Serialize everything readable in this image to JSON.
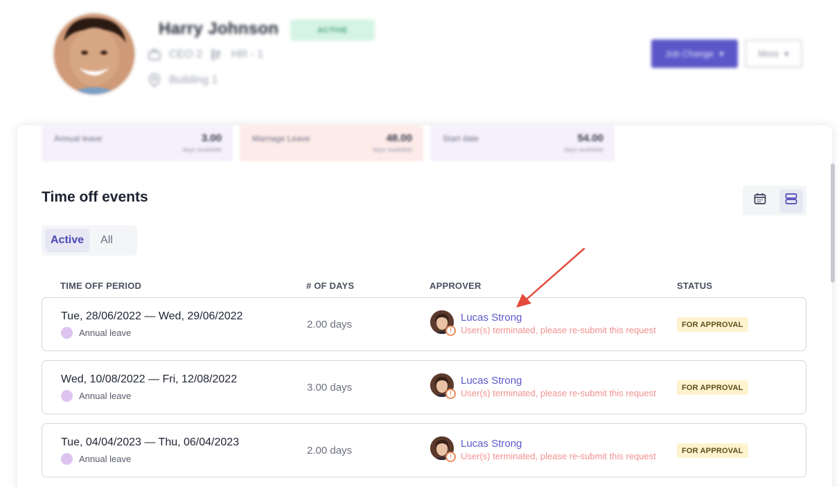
{
  "colors": {
    "accent": "#5b57c9",
    "warning": "#ef8a58",
    "error_text": "#f0918e",
    "status_bg": "#fdf3cf",
    "leave_dot": "#dcc4ef",
    "annotation_arrow": "#e34a3b"
  },
  "employee": {
    "name": "Harry Johnson",
    "status": "ACTIVE",
    "position": "CEO 2",
    "department": "HR - 1",
    "location": "Building 1"
  },
  "header_actions": {
    "job_change_label": "Job Change",
    "more_label": "More"
  },
  "balances": [
    {
      "name": "Annual leave",
      "value": "3.00",
      "sub": "days available"
    },
    {
      "name": "Marriage Leave",
      "value": "48.00",
      "sub": "days available"
    },
    {
      "name": "Start date",
      "value": "54.00",
      "sub": "days available"
    }
  ],
  "section": {
    "title": "Time off events",
    "view_icons": [
      "calendar-icon",
      "list-view-icon"
    ],
    "tabs": [
      {
        "label": "Active",
        "active": true
      },
      {
        "label": "All",
        "active": false
      }
    ]
  },
  "table": {
    "headers": {
      "period": "TIME OFF PERIOD",
      "days": "# OF DAYS",
      "approver": "APPROVER",
      "status": "STATUS"
    },
    "rows": [
      {
        "period": "Tue, 28/06/2022 — Wed, 29/06/2022",
        "leave_type": "Annual leave",
        "days": "2.00 days",
        "approver": "Lucas Strong",
        "approver_note": "User(s) terminated, please re-submit this request",
        "status": "FOR APPROVAL"
      },
      {
        "period": "Wed, 10/08/2022 — Fri, 12/08/2022",
        "leave_type": "Annual leave",
        "days": "3.00 days",
        "approver": "Lucas Strong",
        "approver_note": "User(s) terminated, please re-submit this request",
        "status": "FOR APPROVAL"
      },
      {
        "period": "Tue, 04/04/2023 — Thu, 06/04/2023",
        "leave_type": "Annual leave",
        "days": "2.00 days",
        "approver": "Lucas Strong",
        "approver_note": "User(s) terminated, please re-submit this request",
        "status": "FOR APPROVAL"
      }
    ]
  }
}
